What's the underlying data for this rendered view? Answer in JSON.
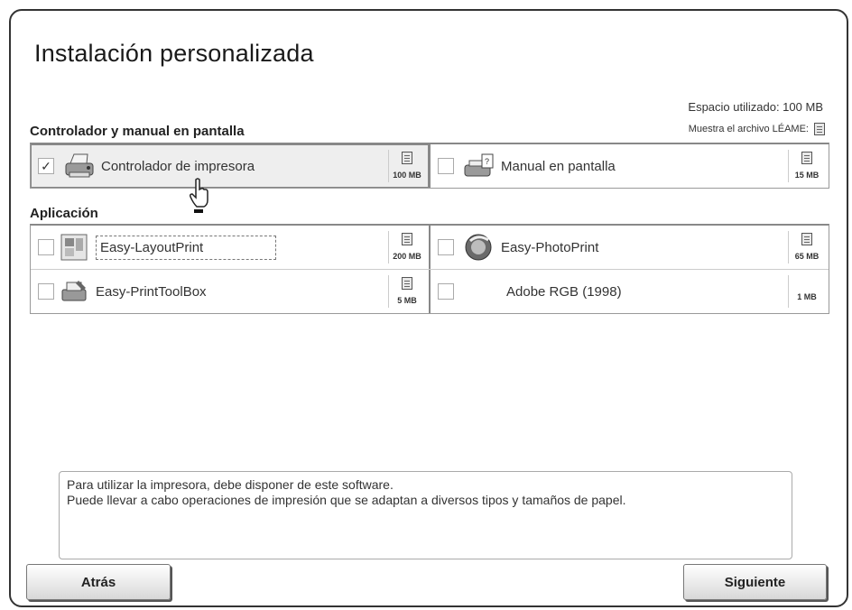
{
  "window": {
    "title": "Instalación personalizada"
  },
  "space_used": "Espacio utilizado: 100 MB",
  "readme_label": "Muestra el archivo LÉAME:",
  "sections": {
    "drivers": {
      "title": "Controlador y manual en pantalla"
    },
    "apps": {
      "title": "Aplicación"
    }
  },
  "items": {
    "printer_driver": {
      "label": "Controlador de impresora",
      "size": "100 MB",
      "checked": true,
      "icon": "printer-icon"
    },
    "onscreen_manual": {
      "label": "Manual en pantalla",
      "size": "15 MB",
      "checked": false,
      "icon": "manual-printer-icon"
    },
    "easy_layoutprint": {
      "label": "Easy-LayoutPrint",
      "size": "200 MB",
      "checked": false,
      "icon": "layout-icon"
    },
    "easy_photoprint": {
      "label": "Easy-PhotoPrint",
      "size": "65 MB",
      "checked": false,
      "icon": "photo-icon"
    },
    "easy_printtoolbox": {
      "label": "Easy-PrintToolBox",
      "size": "5 MB",
      "checked": false,
      "icon": "toolbox-icon"
    },
    "adobe_rgb": {
      "label": "Adobe RGB (1998)",
      "size": "1 MB",
      "checked": false
    }
  },
  "description": {
    "line1": "Para utilizar la impresora, debe disponer de este software.",
    "line2": "Puede llevar a cabo operaciones de impresión que se adaptan a diversos tipos y tamaños de papel."
  },
  "buttons": {
    "back": "Atrás",
    "next": "Siguiente"
  },
  "check_mark": "✓"
}
